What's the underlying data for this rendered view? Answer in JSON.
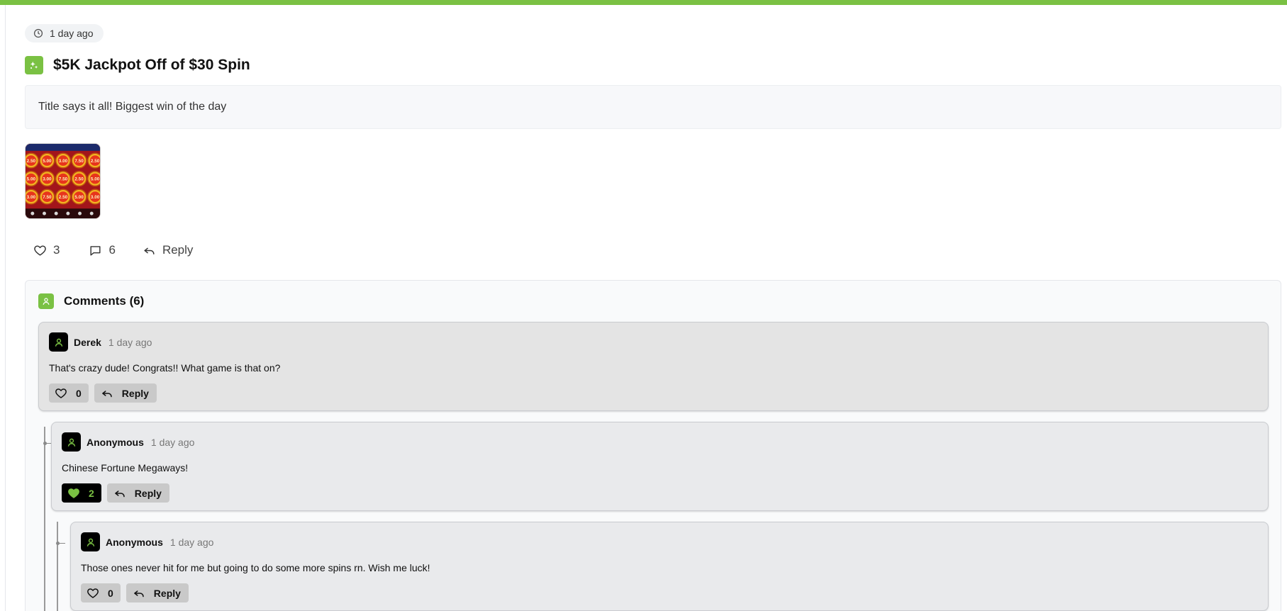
{
  "post": {
    "time_ago": "1 day ago",
    "title": "$5K Jackpot Off of $30 Spin",
    "body": "Title says it all! Biggest win of the day",
    "likes": "3",
    "comment_count": "6",
    "reply_label": "Reply"
  },
  "thumbnail": {
    "values": [
      "2.50",
      "5.00",
      "3.00",
      "7.50"
    ]
  },
  "comments_section": {
    "title": "Comments (6)"
  },
  "comments": [
    {
      "author": "Derek",
      "time": "1 day ago",
      "text": "That's crazy dude! Congrats!! What game is that on?",
      "likes": "0",
      "liked": false,
      "reply_label": "Reply"
    },
    {
      "author": "Anonymous",
      "time": "1 day ago",
      "text": "Chinese Fortune Megaways!",
      "likes": "2",
      "liked": true,
      "reply_label": "Reply"
    },
    {
      "author": "Anonymous",
      "time": "1 day ago",
      "text": "Those ones never hit for me but going to do some more spins rn. Wish me luck!",
      "likes": "0",
      "liked": false,
      "reply_label": "Reply"
    }
  ],
  "colors": {
    "accent": "#7ac143",
    "liked_bg": "#000000",
    "comment_bg": "#e9eaec"
  },
  "icons": {
    "time": "clock-icon",
    "title": "sparkle-icon",
    "like": "heart-icon",
    "comments": "chat-bubble-icon",
    "reply": "reply-arrow-icon",
    "comments_header": "user-icon",
    "avatar": "user-icon"
  }
}
